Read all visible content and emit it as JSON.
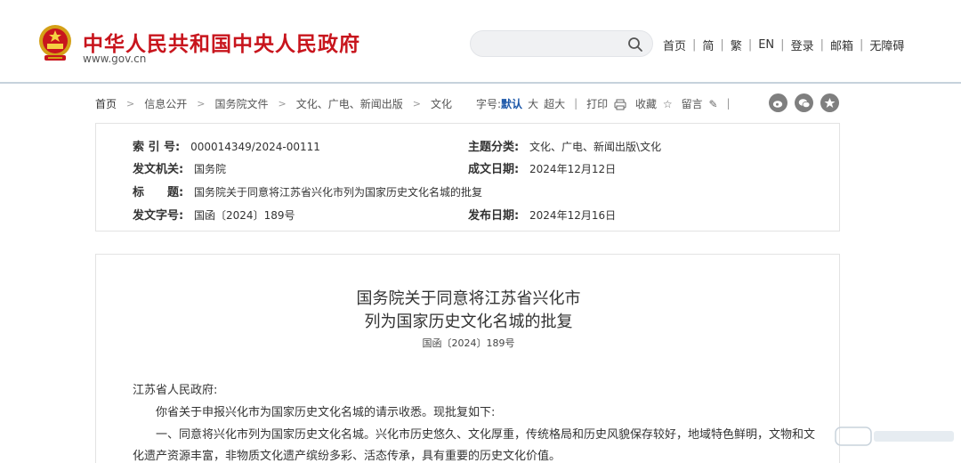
{
  "header": {
    "site_title": "中华人民共和国中央人民政府",
    "site_url": "www.gov.cn",
    "search": {
      "placeholder": ""
    },
    "nav": [
      "首页",
      "简",
      "繁",
      "EN",
      "登录",
      "邮箱",
      "无障碍"
    ]
  },
  "breadcrumb": [
    "首页",
    "信息公开",
    "国务院文件",
    "文化、广电、新闻出版",
    "文化"
  ],
  "tools": {
    "font_label": "字号:",
    "font_default": "默认",
    "font_large": "大",
    "font_xlarge": "超大",
    "print": "打印",
    "favorite": "收藏",
    "comment": "留言"
  },
  "share_icons": [
    "weibo-icon",
    "wechat-icon",
    "qzone-icon"
  ],
  "meta": {
    "index_label": "索 引 号:",
    "index_value": "000014349/2024-00111",
    "topic_label": "主题分类:",
    "topic_value": "文化、广电、新闻出版\\文化",
    "issuer_label": "发文机关:",
    "issuer_value": "国务院",
    "date_label": "成文日期:",
    "date_value": "2024年12月12日",
    "title_label": "标　　题:",
    "title_value": "国务院关于同意将江苏省兴化市列为国家历史文化名城的批复",
    "docno_label": "发文字号:",
    "docno_value": "国函〔2024〕189号",
    "publish_label": "发布日期:",
    "publish_value": "2024年12月16日"
  },
  "document": {
    "title_line1": "国务院关于同意将江苏省兴化市",
    "title_line2": "列为国家历史文化名城的批复",
    "doc_number": "国函〔2024〕189号",
    "salutation": "江苏省人民政府:",
    "p1": "你省关于申报兴化市为国家历史文化名城的请示收悉。现批复如下:",
    "p2_line1": "一、同意将兴化市列为国家历史文化名城。兴化市历史悠久、文化厚重，传统格局和历史风貌保存较好，地域特色鲜明，文物和文",
    "p2_line2": "化遗产资源丰富，非物质文化遗产缤纷多彩、活态传承，具有重要的历史文化价值。"
  },
  "colors": {
    "brand_red": "#c8151d",
    "active_blue": "#1a56a8",
    "share_grey": "#7f7f7f"
  }
}
